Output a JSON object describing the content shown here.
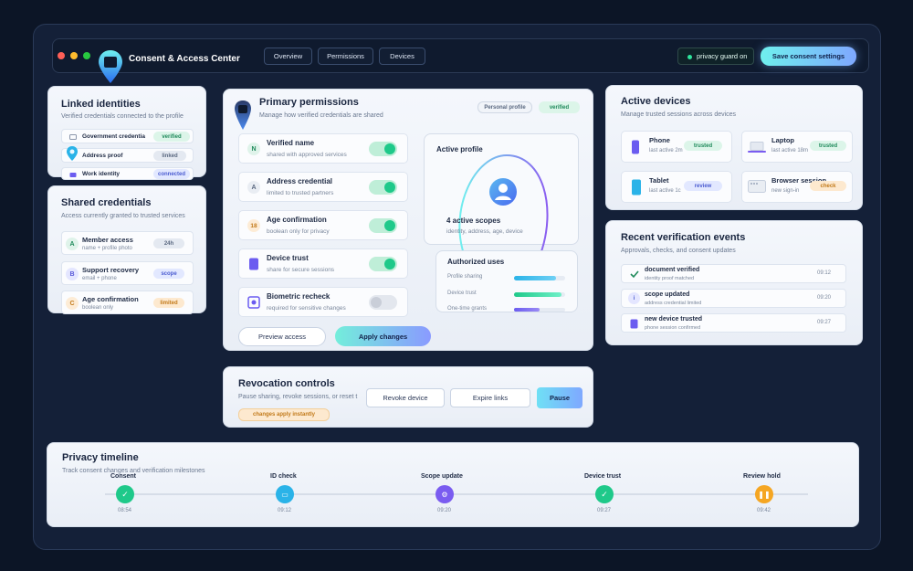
{
  "app": {
    "title": "Consent & Access Center",
    "tabs": [
      "Overview",
      "Permissions",
      "Devices"
    ],
    "guard_label": "privacy guard on",
    "save_label": "Save consent settings"
  },
  "linked_identities": {
    "title": "Linked identities",
    "subtitle": "Verified credentials connected to the profile",
    "items": [
      {
        "label": "Government credentia",
        "badge": "verified"
      },
      {
        "label": "Address proof",
        "badge": "linked"
      },
      {
        "label": "Work identity",
        "badge": "connected"
      }
    ]
  },
  "shared_credentials": {
    "title": "Shared credentials",
    "subtitle": "Access currently granted to trusted services",
    "items": [
      {
        "icon": "A",
        "title": "Member access",
        "sub": "name + profile photo",
        "badge": "24h"
      },
      {
        "icon": "B",
        "title": "Support recovery",
        "sub": "email + phone",
        "badge": "scope"
      },
      {
        "icon": "C",
        "title": "Age confirmation",
        "sub": "boolean only",
        "badge": "limited"
      }
    ]
  },
  "primary_permissions": {
    "title": "Primary permissions",
    "subtitle": "Manage how verified credentials are shared",
    "badges": [
      "Personal profile",
      "verified"
    ],
    "items": [
      {
        "icon": "N",
        "title": "Verified name",
        "sub": "shared with approved services",
        "enabled": true
      },
      {
        "icon": "A",
        "title": "Address credential",
        "sub": "limited to trusted partners",
        "enabled": true
      },
      {
        "icon": "18",
        "title": "Age confirmation",
        "sub": "boolean only for privacy",
        "enabled": true
      },
      {
        "icon": "",
        "title": "Device trust",
        "sub": "share for secure sessions",
        "enabled": true
      },
      {
        "icon": "",
        "title": "Biometric recheck",
        "sub": "required for sensitive changes",
        "enabled": false
      }
    ],
    "preview_label": "Preview access",
    "apply_label": "Apply changes",
    "active_profile": {
      "label": "Active profile",
      "scopes": "4 active scopes",
      "scopes_sub": "identity, address, age, device"
    },
    "authorized_uses": {
      "title": "Authorized uses",
      "items": [
        {
          "label": "Profile sharing",
          "value": 0.82
        },
        {
          "label": "Device trust",
          "value": 0.92
        },
        {
          "label": "One-time grants",
          "value": 0.5
        }
      ]
    }
  },
  "revocation": {
    "title": "Revocation controls",
    "subtitle": "Pause sharing, revoke sessions, or reset t",
    "note": "changes apply instantly",
    "buttons": [
      "Revoke device",
      "Expire links",
      "Pause"
    ]
  },
  "active_devices": {
    "title": "Active devices",
    "subtitle": "Manage trusted sessions across devices",
    "items": [
      {
        "name": "Phone",
        "sub": "last active 2m",
        "badge": "trusted"
      },
      {
        "name": "Laptop",
        "sub": "last active 18m",
        "badge": "trusted"
      },
      {
        "name": "Tablet",
        "sub": "last active 1c",
        "badge": "review"
      },
      {
        "name": "Browser session",
        "sub": "new sign-in",
        "badge": "check"
      }
    ]
  },
  "recent_events": {
    "title": "Recent verification events",
    "subtitle": "Approvals, checks, and consent updates",
    "items": [
      {
        "title": "document verified",
        "sub": "identity proof matched",
        "time": "09:12"
      },
      {
        "title": "scope updated",
        "sub": "address credential limited",
        "time": "09:20"
      },
      {
        "title": "new device trusted",
        "sub": "phone session confirmed",
        "time": "09:27"
      }
    ]
  },
  "timeline": {
    "title": "Privacy timeline",
    "subtitle": "Track consent changes and verification milestones",
    "steps": [
      {
        "label": "Consent",
        "time": "08:54"
      },
      {
        "label": "ID check",
        "time": "09:12"
      },
      {
        "label": "Scope update",
        "time": "09:20"
      },
      {
        "label": "Device trust",
        "time": "09:27"
      },
      {
        "label": "Review hold",
        "time": "09:42"
      }
    ]
  },
  "colors": {
    "accent_teal": "#1fc98a",
    "accent_purple": "#7a5cf0",
    "accent_blue": "#2ab3e8",
    "warning_orange": "#f5a623"
  }
}
